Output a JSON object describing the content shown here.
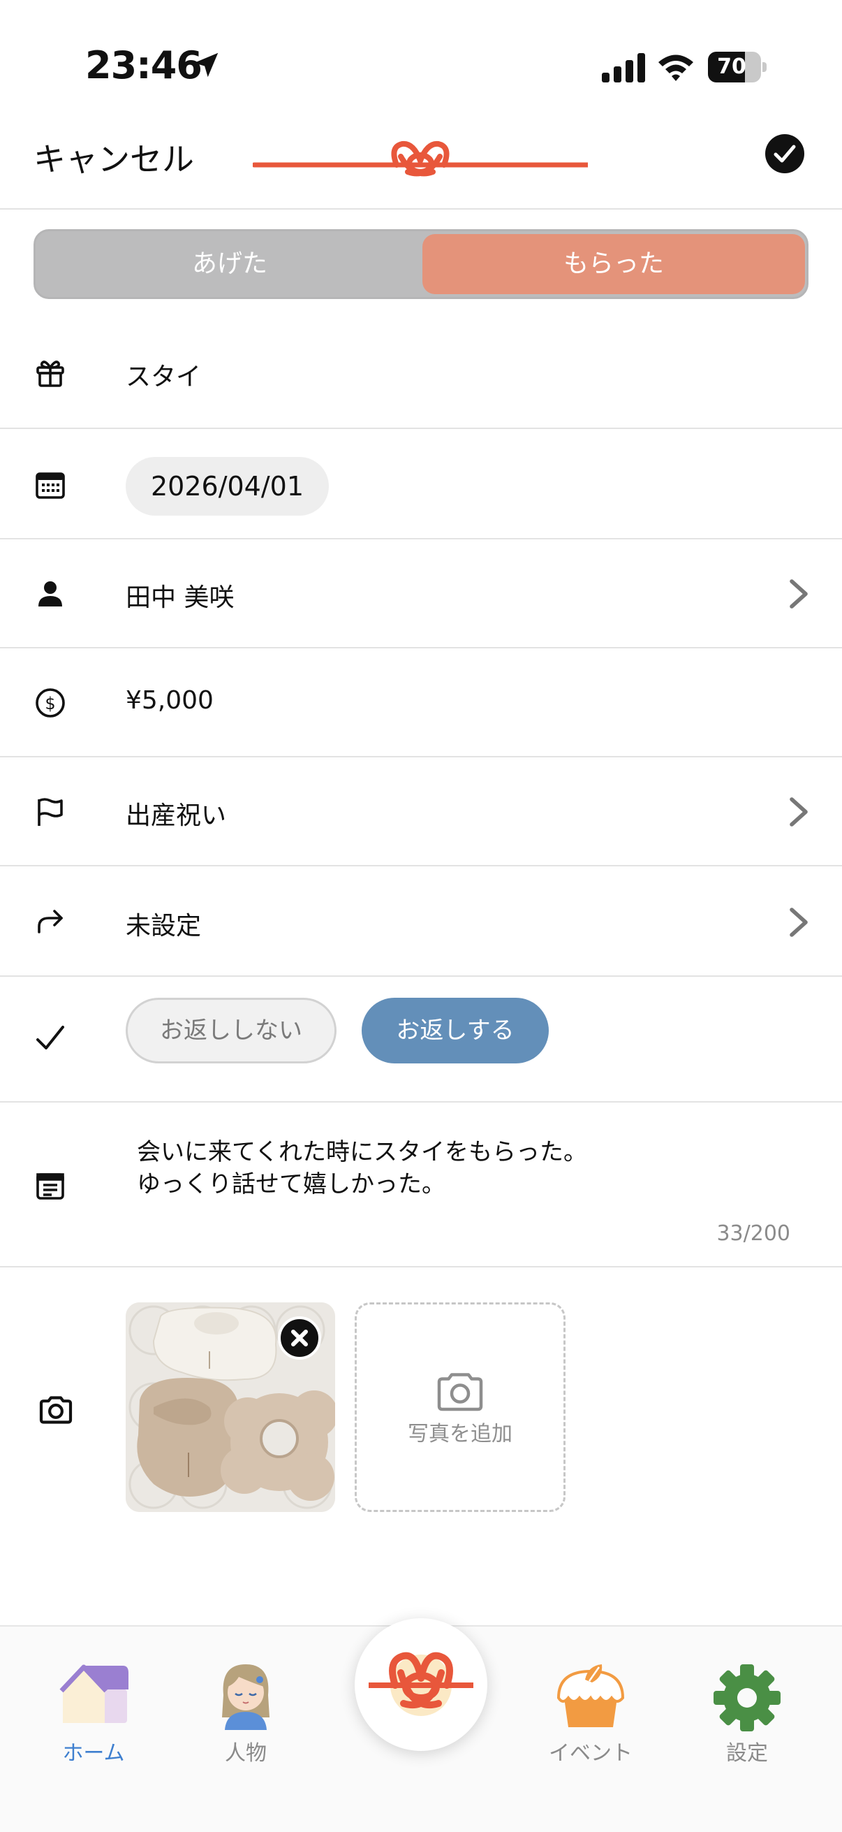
{
  "status_bar": {
    "time": "23:46",
    "battery_level": "70",
    "battery_fraction": 0.7
  },
  "nav": {
    "cancel_label": "キャンセル",
    "confirm_icon": "checkmark-circle-icon",
    "logo_icon": "mizuhiki-knot-icon"
  },
  "segment": {
    "options": [
      "あげた",
      "もらった"
    ],
    "selected": "もらった"
  },
  "form": {
    "gift_name": "スタイ",
    "date": "2026/04/01",
    "person": "田中 美咲",
    "amount": "¥5,000",
    "occasion": "出産祝い",
    "return_gift": "未設定",
    "return_options": [
      "お返ししない",
      "お返しする"
    ],
    "return_selected": "お返しする",
    "memo_lines": [
      "会いに来てくれた時にスタイをもらった。",
      "ゆっくり話せて嬉しかった。"
    ],
    "memo_counter": "33/200",
    "add_photo_label": "写真を追加"
  },
  "tabs": [
    {
      "label": "ホーム",
      "icon": "home-icon",
      "active": true
    },
    {
      "label": "人物",
      "icon": "person-avatar-icon",
      "active": false
    },
    {
      "label": "",
      "icon": "mizuhiki-knot-icon",
      "active": false
    },
    {
      "label": "イベント",
      "icon": "cake-icon",
      "active": false
    },
    {
      "label": "設定",
      "icon": "gear-icon",
      "active": false
    }
  ],
  "colors": {
    "accent_orange": "#e4937a",
    "knot_red": "#e8573b",
    "return_blue": "#638fb9",
    "tab_active_blue": "#3e7fcf",
    "gear_green": "#4a8f45"
  }
}
